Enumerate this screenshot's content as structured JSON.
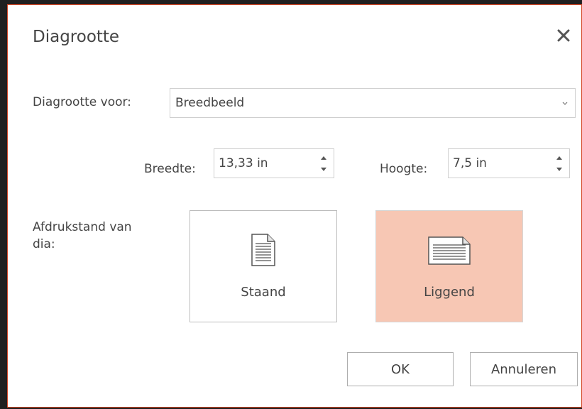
{
  "dialog": {
    "title": "Diagrootte",
    "close_icon": "close-icon"
  },
  "size_for": {
    "label": "Diagrootte voor:",
    "value": "Breedbeeld"
  },
  "width": {
    "label": "Breedte:",
    "value": "13,33 in"
  },
  "height": {
    "label": "Hoogte:",
    "value": "7,5 in"
  },
  "orientation": {
    "label_line1": "Afdrukstand van",
    "label_line2": "dia:",
    "portrait": "Staand",
    "landscape": "Liggend",
    "selected": "landscape"
  },
  "buttons": {
    "ok": "OK",
    "cancel": "Annuleren"
  },
  "colors": {
    "accent_border": "#d24726",
    "selected_fill": "#f7c7b4"
  }
}
